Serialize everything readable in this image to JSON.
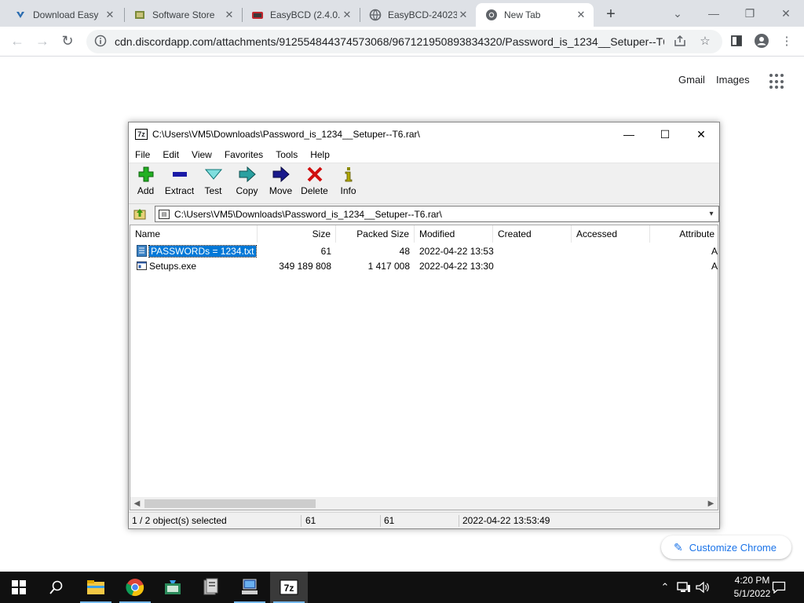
{
  "browser": {
    "tabs": [
      {
        "title": "Download Easy",
        "icon": "download-icon",
        "active": false
      },
      {
        "title": "Software Store",
        "icon": "store-icon",
        "active": false
      },
      {
        "title": "EasyBCD (2.4.0.",
        "icon": "easybcd-icon",
        "active": false
      },
      {
        "title": "EasyBCD-24023",
        "icon": "globe-icon",
        "active": false
      },
      {
        "title": "New Tab",
        "icon": "chrome-icon",
        "active": true
      }
    ],
    "new_tab_symbol": "+",
    "url": "cdn.discordapp.com/attachments/912554844374573068/967121950893834320/Password_is_1234__Setuper--T6....",
    "ntp": {
      "gmail": "Gmail",
      "images": "Images",
      "customize": "Customize Chrome"
    }
  },
  "sevenzip": {
    "title": "C:\\Users\\VM5\\Downloads\\Password_is_1234__Setuper--T6.rar\\",
    "app_icon_text": "7z",
    "menu": [
      "File",
      "Edit",
      "View",
      "Favorites",
      "Tools",
      "Help"
    ],
    "toolbar": [
      {
        "label": "Add",
        "icon": "plus-icon",
        "color": "#2ea82e"
      },
      {
        "label": "Extract",
        "icon": "minus-icon",
        "color": "#1a1aa6"
      },
      {
        "label": "Test",
        "icon": "check-icon",
        "color": "#19a6a6"
      },
      {
        "label": "Copy",
        "icon": "copy-arrow-icon",
        "color": "#19a6a6"
      },
      {
        "label": "Move",
        "icon": "move-arrow-icon",
        "color": "#1a1a8c"
      },
      {
        "label": "Delete",
        "icon": "delete-x-icon",
        "color": "#d01010"
      },
      {
        "label": "Info",
        "icon": "info-icon",
        "color": "#8a8a00"
      }
    ],
    "path": "C:\\Users\\VM5\\Downloads\\Password_is_1234__Setuper--T6.rar\\",
    "columns": [
      "Name",
      "Size",
      "Packed Size",
      "Modified",
      "Created",
      "Accessed",
      "Attribute"
    ],
    "files": [
      {
        "name": "PASSWORDs = 1234.txt",
        "size": "61",
        "packed": "48",
        "modified": "2022-04-22 13:53",
        "attr": "A",
        "selected": true,
        "icon": "text-file-icon"
      },
      {
        "name": "Setups.exe",
        "size": "349 189 808",
        "packed": "1 417 008",
        "modified": "2022-04-22 13:30",
        "attr": "A",
        "selected": false,
        "icon": "exe-file-icon"
      }
    ],
    "status": {
      "selection": "1 / 2 object(s) selected",
      "size": "61",
      "packed": "61",
      "modified": "2022-04-22 13:53:49"
    }
  },
  "taskbar": {
    "time": "4:20 PM",
    "date": "5/1/2022"
  }
}
